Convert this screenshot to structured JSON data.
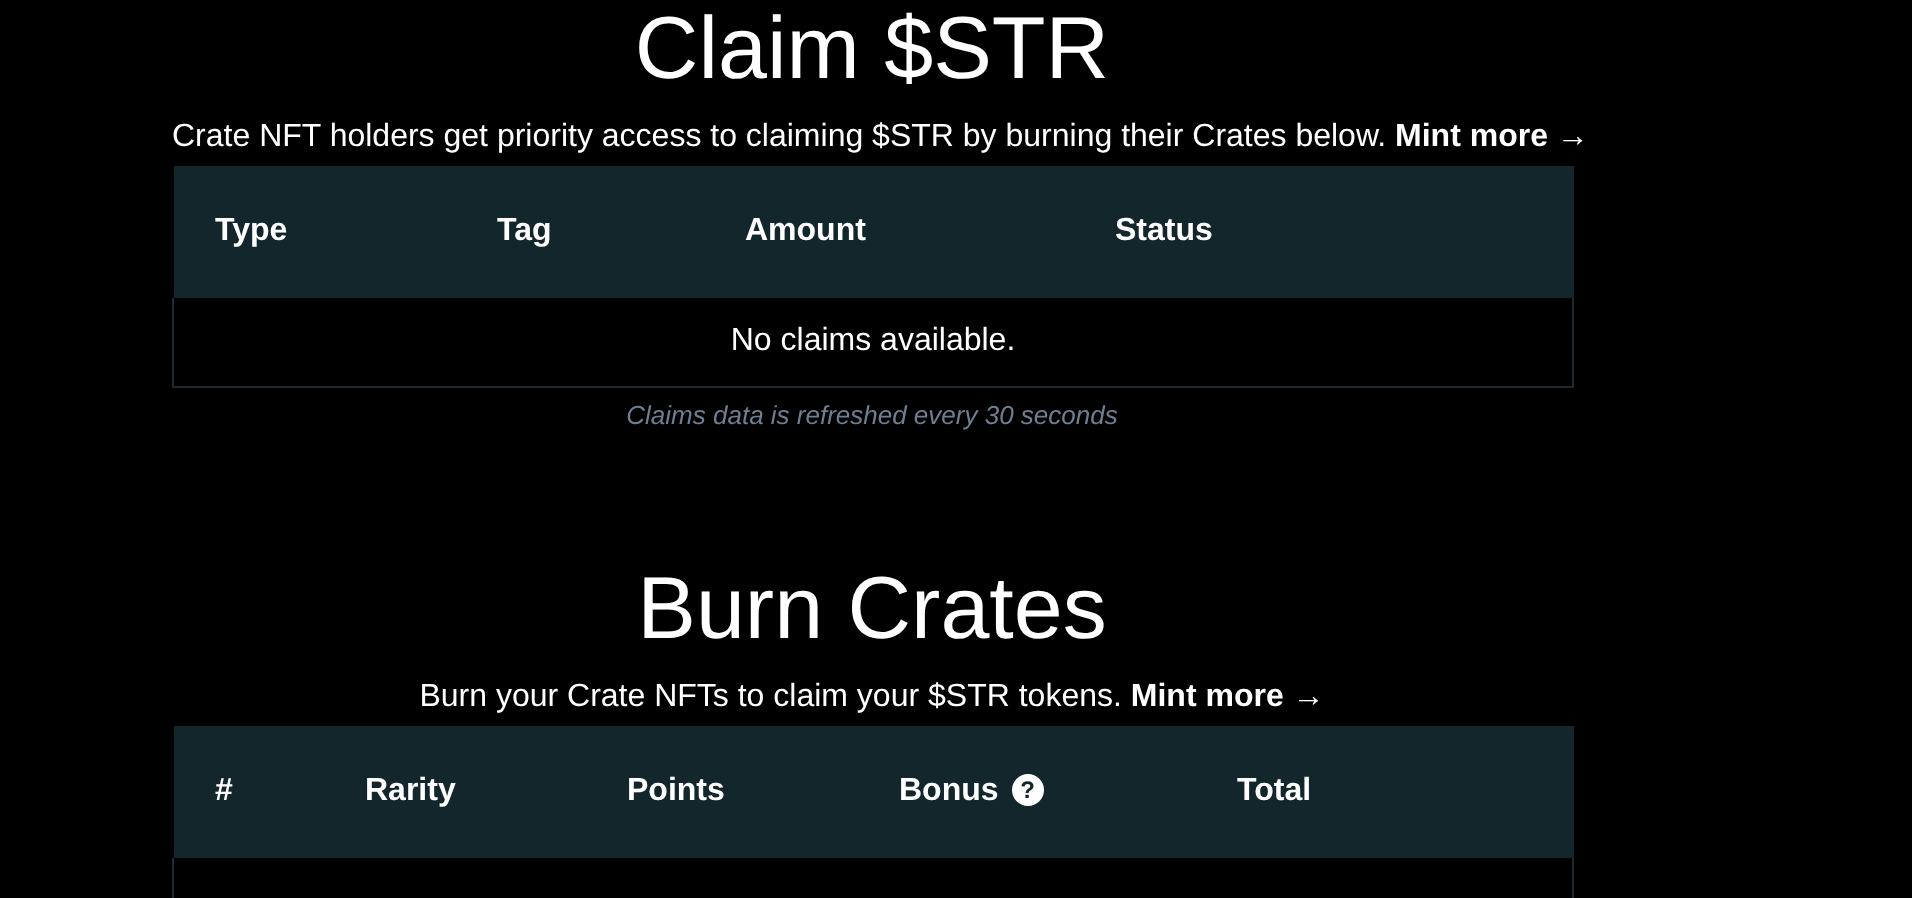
{
  "sections": [
    {
      "title": "Claim $STR",
      "description": "Crate NFT holders get priority access to claiming $STR by burning their Crates below.",
      "link": {
        "label": "Mint more",
        "arrow": "→"
      },
      "table": {
        "columns": [
          {
            "label": "Type"
          },
          {
            "label": "Tag"
          },
          {
            "label": "Amount"
          },
          {
            "label": "Status"
          }
        ],
        "empty_message": "No claims available."
      },
      "footnote": "Claims data is refreshed every 30 seconds"
    },
    {
      "title": "Burn Crates",
      "description": "Burn your Crate NFTs to claim your $STR tokens.",
      "link": {
        "label": "Mint more",
        "arrow": "→"
      },
      "table": {
        "columns": [
          {
            "label": "#"
          },
          {
            "label": "Rarity"
          },
          {
            "label": "Points"
          },
          {
            "label": "Bonus",
            "help_icon": "?"
          },
          {
            "label": "Total"
          }
        ]
      }
    }
  ]
}
